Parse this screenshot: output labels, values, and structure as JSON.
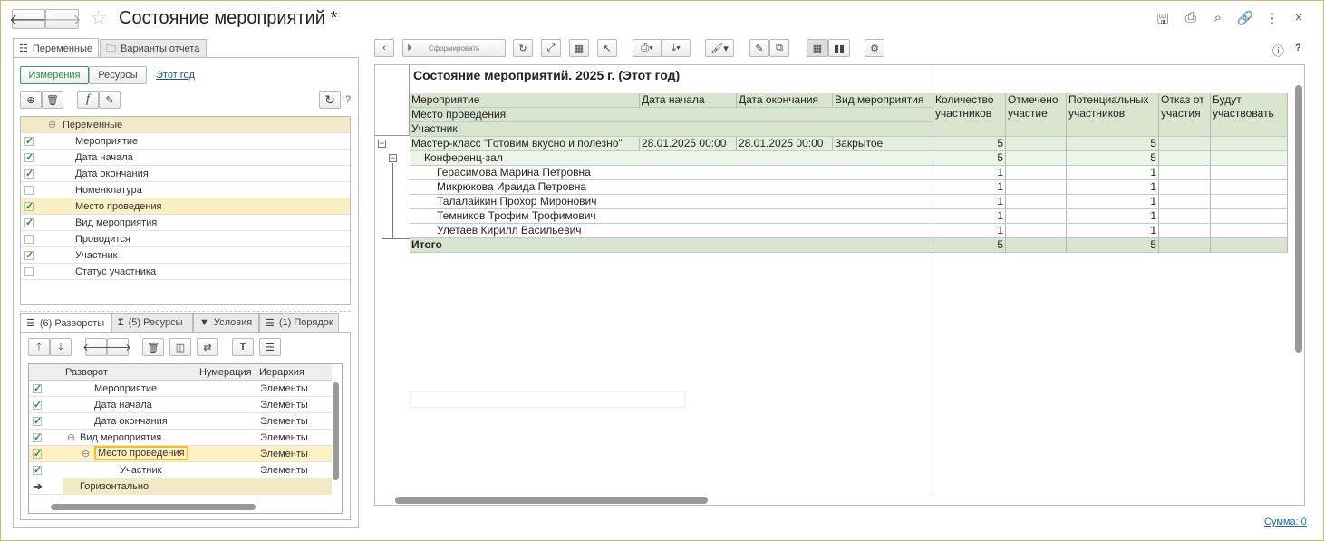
{
  "title": "Состояние мероприятий *",
  "header_icons": [
    "save-icon",
    "print-icon",
    "preview-icon",
    "link-icon",
    "more-icon",
    "close-icon"
  ],
  "left": {
    "tabs": [
      "Переменные",
      "Варианты отчета"
    ],
    "mode_buttons": [
      "Измерения",
      "Ресурсы"
    ],
    "period_link": "Этот год",
    "help": "?",
    "tree_root": "Переменные",
    "tree_items": [
      {
        "label": "Мероприятие",
        "checked": true
      },
      {
        "label": "Дата начала",
        "checked": true
      },
      {
        "label": "Дата окончания",
        "checked": true
      },
      {
        "label": "Номенклатура",
        "checked": false
      },
      {
        "label": "Место проведения",
        "checked": true
      },
      {
        "label": "Вид мероприятия",
        "checked": true
      },
      {
        "label": "Проводится",
        "checked": false
      },
      {
        "label": "Участник",
        "checked": true
      },
      {
        "label": "Статус участника",
        "checked": false
      }
    ],
    "bottom_tabs": [
      "(6) Развороты",
      "(5) Ресурсы",
      "Условия",
      "(1) Порядок"
    ],
    "grid_headers": [
      "Разворот",
      "Нумерация",
      "Иерархия"
    ],
    "grid_rows": [
      {
        "label": "Мероприятие",
        "hier": "Элементы"
      },
      {
        "label": "Дата начала",
        "hier": "Элементы"
      },
      {
        "label": "Дата окончания",
        "hier": "Элементы"
      },
      {
        "label": "Вид мероприятия",
        "hier": "Элементы"
      },
      {
        "label": "Место проведения",
        "hier": "Элементы"
      },
      {
        "label": "Участник",
        "hier": "Элементы"
      }
    ],
    "grid_footer": "Горизонтально"
  },
  "toolbar": {
    "generate": "Сформировать",
    "info": "ⓘ",
    "help": "?"
  },
  "report": {
    "title": "Состояние мероприятий. 2025 г. (Этот год)",
    "headers": [
      "Мероприятие",
      "Дата начала",
      "Дата окончания",
      "Вид мероприятия"
    ],
    "header2": "Место проведения",
    "header3": "Участник",
    "res_headers": [
      "Количество участников",
      "Отмечено участие",
      "Потенциальных участников",
      "Отказ от участия",
      "Будут участвовать"
    ],
    "event": {
      "name": "Мастер-класс \"Готовим вкусно и полезно\"",
      "start": "28.01.2025 00:00",
      "end": "28.01.2025 00:00",
      "kind": "Закрытое",
      "count": "5",
      "potential": "5"
    },
    "place": {
      "name": "Конференц-зал",
      "count": "5",
      "potential": "5"
    },
    "participants": [
      {
        "name": "Герасимова Марина Петровна",
        "count": "1",
        "potential": "1"
      },
      {
        "name": "Микрюкова Ираида Петровна",
        "count": "1",
        "potential": "1"
      },
      {
        "name": "Талалайкин Прохор Миронович",
        "count": "1",
        "potential": "1"
      },
      {
        "name": "Темников Трофим Трофимович",
        "count": "1",
        "potential": "1"
      },
      {
        "name": "Улетаев Кирилл Васильевич",
        "count": "1",
        "potential": "1"
      }
    ],
    "total": {
      "label": "Итого",
      "count": "5",
      "potential": "5"
    }
  },
  "footer": {
    "sum": "Сумма: 0"
  }
}
